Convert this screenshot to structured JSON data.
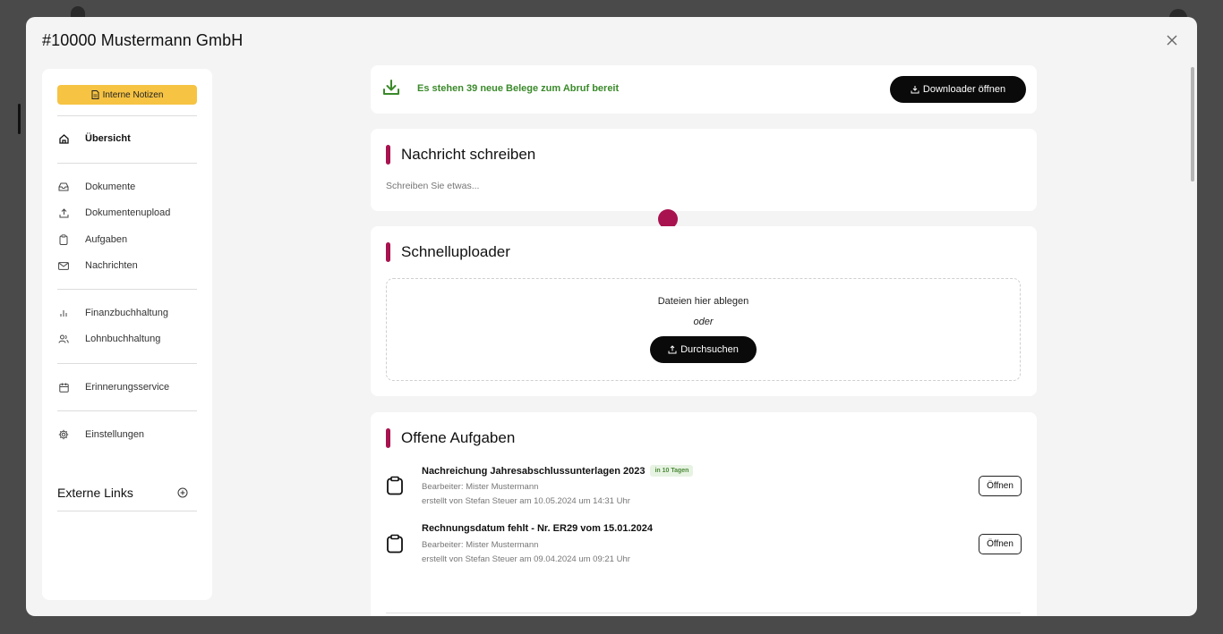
{
  "modal": {
    "title": "#10000 Mustermann GmbH"
  },
  "sidebar": {
    "notes_label": "Interne Notizen",
    "overview": {
      "label": "Übersicht",
      "icon": "home-icon"
    },
    "group1": [
      {
        "label": "Dokumente",
        "icon": "inbox-icon"
      },
      {
        "label": "Dokumentenupload",
        "icon": "upload-icon"
      },
      {
        "label": "Aufgaben",
        "icon": "clipboard-icon"
      },
      {
        "label": "Nachrichten",
        "icon": "mail-icon"
      }
    ],
    "group2": [
      {
        "label": "Finanzbuchhaltung",
        "icon": "bar-chart-icon"
      },
      {
        "label": "Lohnbuchhaltung",
        "icon": "users-icon"
      }
    ],
    "group3": [
      {
        "label": "Erinnerungsservice",
        "icon": "calendar-icon"
      }
    ],
    "group4": [
      {
        "label": "Einstellungen",
        "icon": "gear-icon"
      }
    ],
    "external_links": "Externe Links"
  },
  "banner": {
    "text": "Es stehen 39 neue Belege zum Abruf bereit",
    "button_label": "Downloader öffnen"
  },
  "message": {
    "title": "Nachricht schreiben",
    "placeholder": "Schreiben Sie etwas..."
  },
  "uploader": {
    "title": "Schnelluploader",
    "drop_text": "Dateien hier ablegen",
    "or_text": "oder",
    "browse_label": "Durchsuchen"
  },
  "tasks": {
    "title": "Offene Aufgaben",
    "open_label": "Öffnen",
    "items": [
      {
        "title": "Nachreichung Jahresabschlussunterlagen 2023",
        "badge": "in 10 Tagen",
        "editor": "Bearbeiter: Mister Mustermann",
        "meta": "erstellt von Stefan Steuer am 10.05.2024 um 14:31 Uhr"
      },
      {
        "title": "Rechnungsdatum fehlt - Nr. ER29 vom 15.01.2024",
        "badge": "",
        "editor": "Bearbeiter: Mister Mustermann",
        "meta": "erstellt von Stefan Steuer am 09.04.2024 um 09:21 Uhr"
      }
    ]
  },
  "colors": {
    "accent": "#a8124f",
    "notes": "#f6c343",
    "success": "#3a8a2a"
  }
}
